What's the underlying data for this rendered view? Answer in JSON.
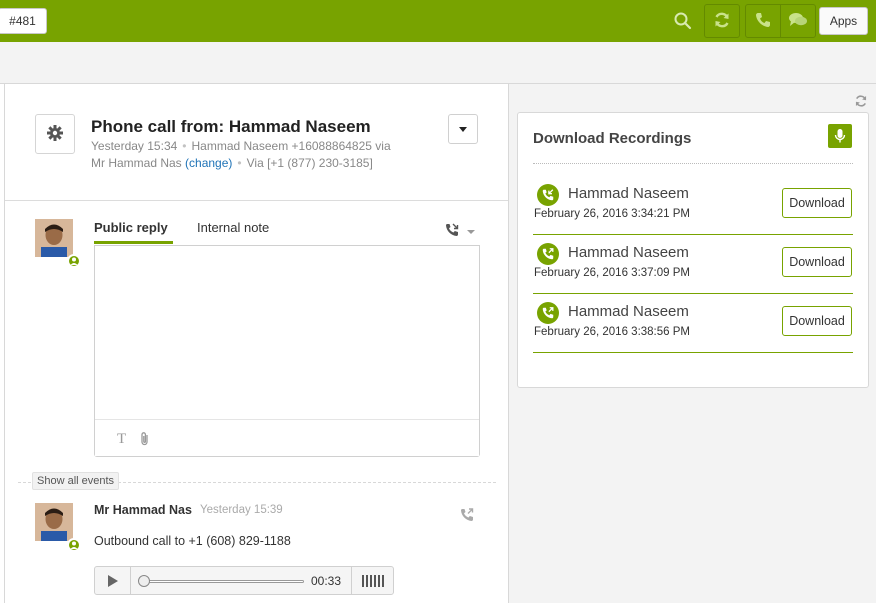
{
  "topbar": {
    "icons": [
      "search-icon",
      "refresh-icon",
      "phone-icon",
      "chat-icon",
      "avatar",
      "caret-down-icon"
    ],
    "accent": "#78a300"
  },
  "subbar": {
    "ticket_tab": "#481",
    "apps_label": "Apps"
  },
  "ticket": {
    "title": "Phone call from: Hammad Naseem",
    "time": "Yesterday 15:34",
    "caller": "Hammad Naseem +16088864825 via",
    "requester": "Mr Hammad Nas",
    "change_link": "(change)",
    "via": "Via [+1 (877) 230-3185]"
  },
  "reply": {
    "tab_public": "Public reply",
    "tab_internal": "Internal note",
    "format_icon": "T",
    "textarea_value": ""
  },
  "events": {
    "show_all": "Show all events"
  },
  "comment": {
    "author": "Mr Hammad Nas",
    "time": "Yesterday 15:39",
    "body": "Outbound call to +1 (608) 829-1188",
    "audio_time": "00:33",
    "audio_progress": 0.0
  },
  "app": {
    "title": "Download Recordings",
    "recordings": [
      {
        "name": "Hammad Naseem",
        "date": "February 26, 2016 3:34:21 PM",
        "button": "Download",
        "direction": "inbound"
      },
      {
        "name": "Hammad Naseem",
        "date": "February 26, 2016 3:37:09 PM",
        "button": "Download",
        "direction": "outbound"
      },
      {
        "name": "Hammad Naseem",
        "date": "February 26, 2016 3:38:56 PM",
        "button": "Download",
        "direction": "outbound"
      }
    ]
  }
}
